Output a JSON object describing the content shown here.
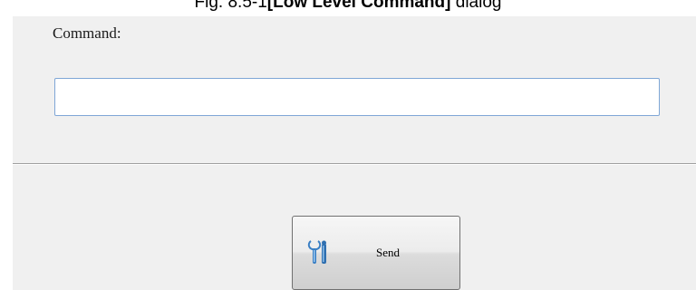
{
  "caption": {
    "prefix": "Fig. 8.5-1",
    "bold": "[Low Level Command]",
    "suffix": " dialog"
  },
  "dialog": {
    "command_label": "Command:",
    "command_value": "",
    "send_label": "Send",
    "send_icon": "wrench-tools-icon"
  },
  "colors": {
    "dialog_bg": "#f0f0f0",
    "input_border": "#7fa6d6",
    "icon_blue": "#3a7fc4"
  }
}
